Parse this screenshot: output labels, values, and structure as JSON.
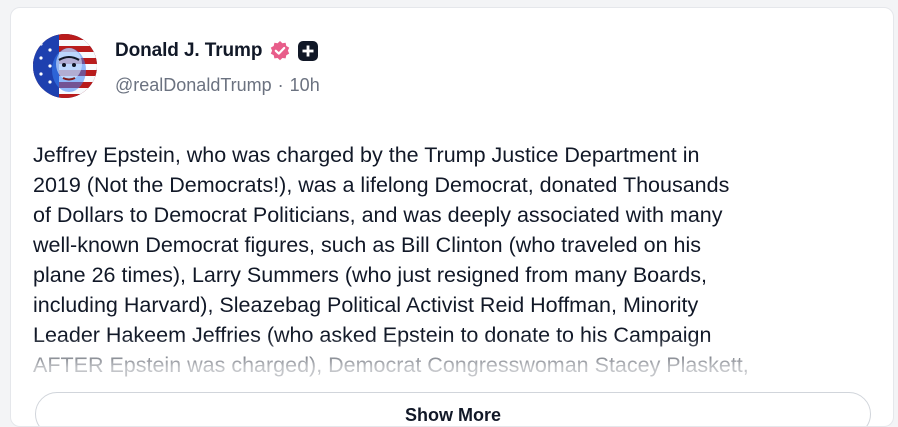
{
  "post": {
    "author": {
      "display_name": "Donald J. Trump",
      "handle": "@realDonaldTrump",
      "avatar_icon": "flag-portrait-avatar",
      "verified_icon": "verified-badge-icon",
      "verified_color": "#e85d8a"
    },
    "separator": "·",
    "timestamp": "10h",
    "text": "Jeffrey Epstein, who was charged by the Trump Justice Department in\n2019 (Not the Democrats!), was a lifelong Democrat, donated Thousands\nof Dollars to Democrat Politicians, and was deeply associated with many\nwell-known Democrat figures, such as Bill Clinton (who traveled on his\nplane 26 times), Larry Summers (who just resigned from many Boards,\nincluding Harvard), Sleazebag Political Activist Reid Hoffman, Minority\nLeader Hakeem Jeffries (who asked Epstein to donate to his Campaign\nAFTER Epstein was charged), Democrat Congresswoman Stacey Plaskett,",
    "show_more_label": "Show More"
  }
}
